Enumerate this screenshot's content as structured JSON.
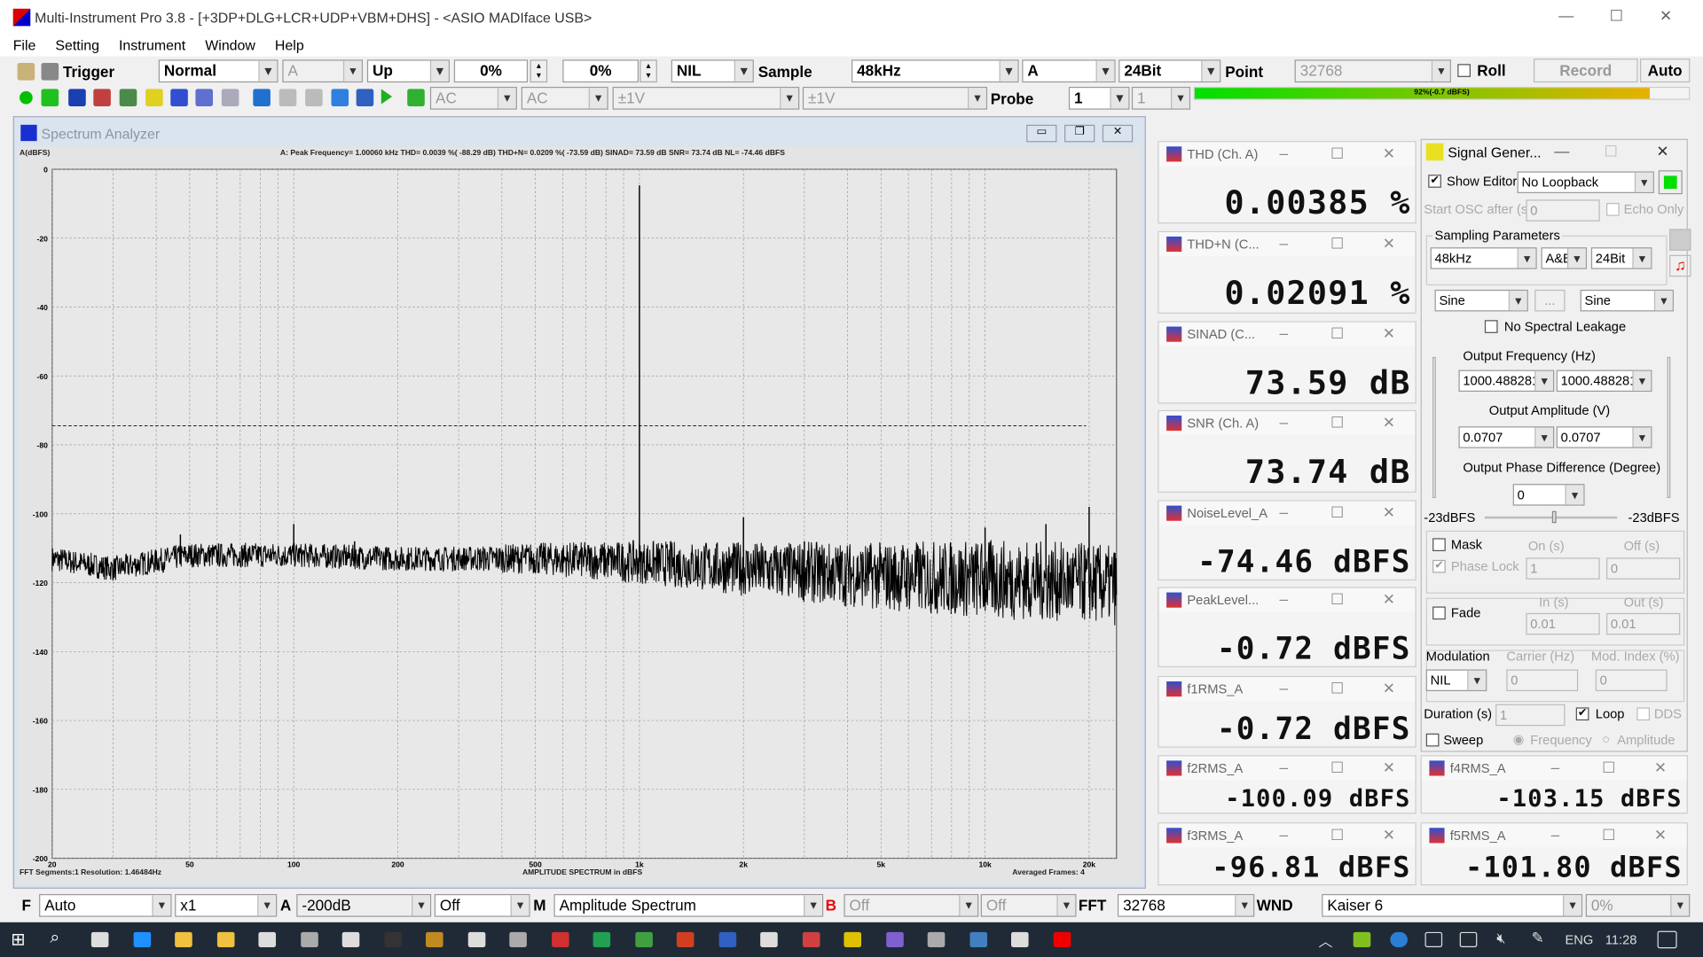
{
  "window": {
    "title": "Multi-Instrument Pro 3.8   -   [+3DP+DLG+LCR+UDP+VBM+DHS]   -   <ASIO MADIface USB>"
  },
  "menu": [
    "File",
    "Setting",
    "Instrument",
    "Window",
    "Help"
  ],
  "toolbar1": {
    "trigger_label": "Trigger",
    "trigger_mode": "Normal",
    "trigger_channel": "A",
    "trigger_edge": "Up",
    "level1": "0%",
    "level2": "0%",
    "nil": "NIL",
    "sample_label": "Sample",
    "sample_rate": "48kHz",
    "channel": "A",
    "bit_depth": "24Bit",
    "point_label": "Point",
    "points": "32768",
    "roll_label": "Roll",
    "record_label": "Record",
    "auto_label": "Auto"
  },
  "toolbar2": {
    "coupling_a": "AC",
    "coupling_b": "AC",
    "range_a": "±1V",
    "range_b": "±1V",
    "probe_label": "Probe",
    "probe_a": "1",
    "probe_b": "1",
    "level_meter_text": "92%(-0.7 dBFS)",
    "level_meter_fraction": 0.92,
    "level_color_start": "#00e000",
    "level_color_end": "#e8b000"
  },
  "spectrum": {
    "title": "Spectrum Analyzer",
    "ylabel": "A(dBFS)",
    "header": "A: Peak Frequency=   1.00060  kHz  THD=   0.0039 %(  -88.29 dB)  THD+N=   0.0209 %(  -73.59 dB)  SINAD=   73.59 dB  SNR=   73.74 dB  NL=   -74.46 dBFS",
    "logo": "MI",
    "footer_left": "FFT Segments:1    Resolution: 1.46484Hz",
    "footer_center": "AMPLITUDE SPECTRUM in dBFS",
    "footer_right": "Averaged Frames: 4"
  },
  "chart_data": {
    "type": "line",
    "xscale": "log",
    "xlim": [
      20,
      24000
    ],
    "ylim": [
      -200,
      0
    ],
    "ylabel": "A(dBFS)",
    "xlabel": "AMPLITUDE SPECTRUM in dBFS",
    "grid": true,
    "xticks": [
      {
        "v": 20,
        "l": "20"
      },
      {
        "v": 50,
        "l": "50"
      },
      {
        "v": 100,
        "l": "100"
      },
      {
        "v": 200,
        "l": "200"
      },
      {
        "v": 500,
        "l": "500"
      },
      {
        "v": 1000,
        "l": "1k"
      },
      {
        "v": 2000,
        "l": "2k"
      },
      {
        "v": 5000,
        "l": "5k"
      },
      {
        "v": 10000,
        "l": "10k"
      },
      {
        "v": 20000,
        "l": "20k"
      }
    ],
    "yticks": [
      0,
      -20,
      -40,
      -60,
      -80,
      -100,
      -120,
      -140,
      -160,
      -180,
      -200
    ],
    "noise_floor": [
      [
        20,
        -113
      ],
      [
        30,
        -116
      ],
      [
        50,
        -112
      ],
      [
        100,
        -112
      ],
      [
        200,
        -113
      ],
      [
        500,
        -113
      ],
      [
        1000,
        -114
      ],
      [
        2000,
        -116
      ],
      [
        5000,
        -118
      ],
      [
        10000,
        -119
      ],
      [
        20000,
        -120
      ],
      [
        24000,
        -121
      ]
    ],
    "peaks": [
      [
        1000,
        -4.7
      ],
      [
        47,
        -106
      ],
      [
        60,
        -111
      ],
      [
        100,
        -103
      ],
      [
        150,
        -108
      ],
      [
        2000,
        -101
      ],
      [
        3000,
        -108
      ],
      [
        10000,
        -104
      ],
      [
        15000,
        -103
      ],
      [
        20000,
        -98
      ]
    ],
    "noise_level_line": -74.46,
    "color": "#000000"
  },
  "meters": [
    {
      "title": "THD (Ch. A)",
      "value": "0.00385 %"
    },
    {
      "title": "THD+N (C...",
      "value": "0.02091 %"
    },
    {
      "title": "SINAD (C...",
      "value": "73.59 dB"
    },
    {
      "title": "SNR (Ch. A)",
      "value": "73.74 dB"
    },
    {
      "title": "NoiseLevel_A",
      "value": "-74.46 dBFS"
    },
    {
      "title": "PeakLevel...",
      "value": "-0.72 dBFS"
    },
    {
      "title": "f1RMS_A",
      "value": "-0.72 dBFS"
    },
    {
      "title": "f2RMS_A",
      "value": "-100.09 dBFS"
    },
    {
      "title": "f3RMS_A",
      "value": "-96.81 dBFS"
    },
    {
      "title": "f4RMS_A",
      "value": "-103.15 dBFS"
    },
    {
      "title": "f5RMS_A",
      "value": "-101.80 dBFS"
    }
  ],
  "siggen": {
    "title": "Signal Gener...",
    "show_editor": "Show Editor",
    "loopback": "No Loopback",
    "start_osc": "Start OSC after (s)",
    "start_osc_val": "0",
    "echo_only": "Echo Only",
    "sampling": "Sampling Parameters",
    "rate": "48kHz",
    "ch": "A&B",
    "bits": "24Bit",
    "wave_a": "Sine",
    "more": "...",
    "wave_b": "Sine",
    "no_leak": "No Spectral Leakage",
    "freq_label": "Output Frequency (Hz)",
    "freq_a": "1000.488281",
    "freq_b": "1000.488281",
    "amp_label": "Output Amplitude (V)",
    "amp_a": "0.0707",
    "amp_b": "0.0707",
    "phase_label": "Output Phase Difference (Degree)",
    "phase": "0",
    "lvl_a": "-23dBFS",
    "lvl_b": "-23dBFS",
    "mask": "Mask",
    "on": "On (s)",
    "off": "Off (s)",
    "phase_lock": "Phase Lock",
    "on_val": "1",
    "off_val": "0",
    "fade": "Fade",
    "in": "In (s)",
    "out": "Out (s)",
    "in_val": "0.01",
    "out_val": "0.01",
    "modulation": "Modulation",
    "carrier": "Carrier (Hz)",
    "mod_index": "Mod. Index (%)",
    "mod_val": "NIL",
    "carrier_val": "0",
    "index_val": "0",
    "duration": "Duration (s)",
    "duration_val": "1",
    "loop": "Loop",
    "dds": "DDS",
    "sweep": "Sweep",
    "frequency": "Frequency",
    "amplitude": "Amplitude",
    "run_color": "#00e000"
  },
  "bottombar": {
    "f": "F",
    "f_val": "Auto",
    "mult": "x1",
    "a": "A",
    "a_val": "-200dB",
    "a_off": "Off",
    "m": "M",
    "mode": "Amplitude Spectrum",
    "b": "B",
    "b_val": "Off",
    "b_off": "Off",
    "fft": "FFT",
    "fft_val": "32768",
    "wnd": "WND",
    "window": "Kaiser 6",
    "overlap": "0%"
  },
  "taskbar": {
    "lang": "ENG",
    "time": "11:28"
  }
}
